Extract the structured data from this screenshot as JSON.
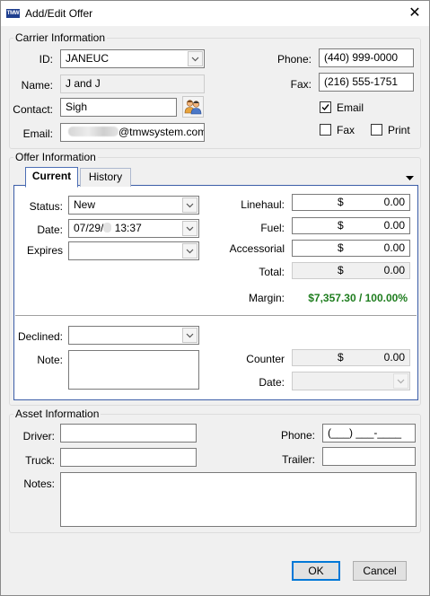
{
  "window": {
    "title": "Add/Edit Offer",
    "icon_text": "TMW",
    "close_glyph": "✕"
  },
  "carrier": {
    "legend": "Carrier Information",
    "id_label": "ID:",
    "id_value": "JANEUC",
    "name_label": "Name:",
    "name_value": "J and J",
    "contact_label": "Contact:",
    "contact_value": "Sigh",
    "email_label": "Email:",
    "email_domain": "@tmwsystem.com",
    "phone_label": "Phone:",
    "phone_value": "(440) 999-0000",
    "fax_label": "Fax:",
    "fax_value": "(216) 555-1751",
    "email_check_label": "Email",
    "email_checked": true,
    "fax_check_label": "Fax",
    "fax_checked": false,
    "print_check_label": "Print",
    "print_checked": false
  },
  "offer": {
    "legend": "Offer Information",
    "tabs": [
      {
        "label": "Current"
      },
      {
        "label": "History"
      }
    ],
    "status_label": "Status:",
    "status_value": "New",
    "date_label": "Date:",
    "date_prefix": "07/29/",
    "date_suffix": " 13:37",
    "expires_label": "Expires",
    "expires_value": "",
    "linehaul_label": "Linehaul:",
    "linehaul_currency": "$",
    "linehaul_amount": "0.00",
    "fuel_label": "Fuel:",
    "fuel_currency": "$",
    "fuel_amount": "0.00",
    "accessorial_label": "Accessorial",
    "accessorial_currency": "$",
    "accessorial_amount": "0.00",
    "total_label": "Total:",
    "total_currency": "$",
    "total_amount": "0.00",
    "margin_label": "Margin:",
    "margin_value": "$7,357.30 / 100.00%",
    "declined_label": "Declined:",
    "declined_value": "",
    "note_label": "Note:",
    "note_value": "",
    "counter_label": "Counter",
    "counter_currency": "$",
    "counter_amount": "0.00",
    "counter_date_label": "Date:",
    "counter_date_value": ""
  },
  "asset": {
    "legend": "Asset Information",
    "driver_label": "Driver:",
    "driver_value": "",
    "truck_label": "Truck:",
    "truck_value": "",
    "notes_label": "Notes:",
    "notes_value": "",
    "phone_label": "Phone:",
    "phone_value": "(___) ___-____",
    "trailer_label": "Trailer:",
    "trailer_value": ""
  },
  "buttons": {
    "ok": "OK",
    "cancel": "Cancel"
  },
  "colors": {
    "margin_green": "#1e7d1e",
    "tab_border": "#3c5ea8",
    "default_button": "#0078d7"
  },
  "icons": {
    "contact_lookup": "people-icon",
    "dropdown": "chevron-down-icon",
    "menu": "triangle-down-icon",
    "check": "checkmark-icon"
  }
}
